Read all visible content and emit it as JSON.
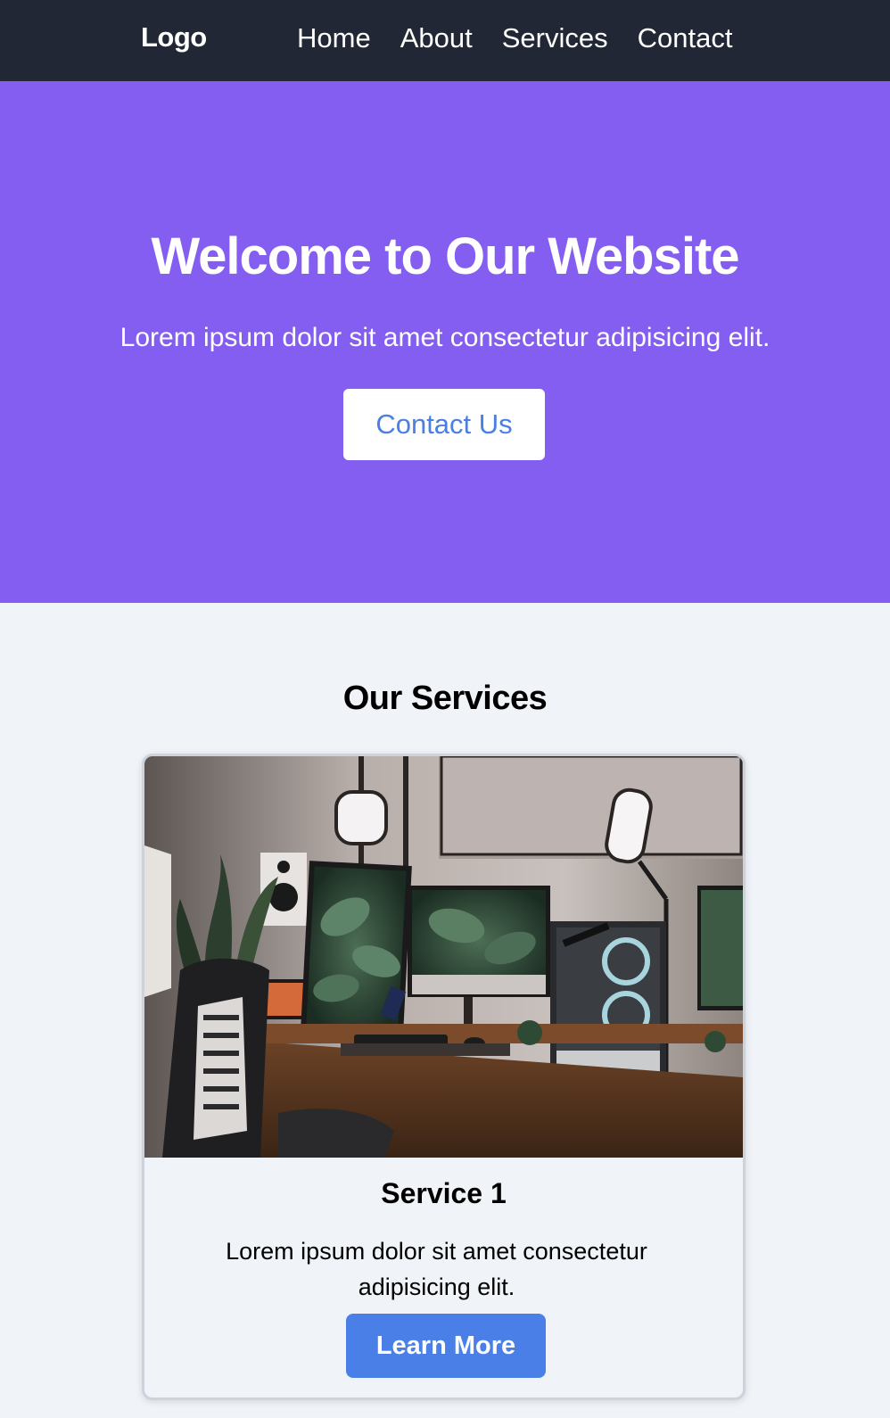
{
  "nav": {
    "logo": "Logo",
    "links": [
      {
        "label": "Home"
      },
      {
        "label": "About"
      },
      {
        "label": "Services"
      },
      {
        "label": "Contact"
      }
    ]
  },
  "hero": {
    "title": "Welcome to Our Website",
    "subtitle": "Lorem ipsum dolor sit amet consectetur adipisicing elit.",
    "button_label": "Contact Us"
  },
  "services": {
    "title": "Our Services",
    "cards": [
      {
        "title": "Service 1",
        "text": "Lorem ipsum dolor sit amet consectetur adipisicing elit.",
        "button_label": "Learn More",
        "image": "photo of a desk setup with monitors, plant wallpaper, PC tower, ring lights and office chair"
      }
    ]
  },
  "colors": {
    "nav_bg": "#212734",
    "hero_bg": "#845ef0",
    "page_bg": "#f0f4f8",
    "primary_button": "#4a7fe8",
    "hero_button_text": "#4a7fe4"
  }
}
